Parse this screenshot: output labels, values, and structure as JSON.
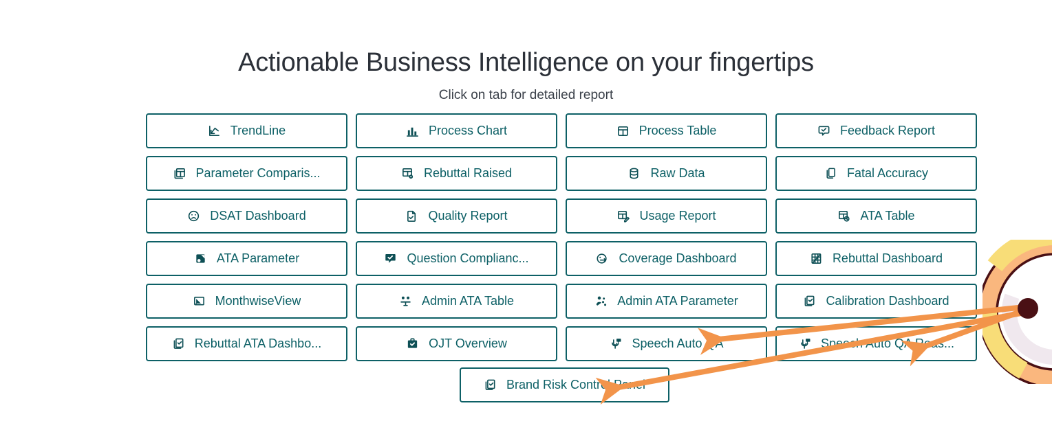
{
  "header": {
    "title": "Actionable Business Intelligence on your fingertips",
    "subtitle": "Click on tab for detailed report"
  },
  "colors": {
    "tab_border": "#0d6066",
    "tab_text": "#0d6066",
    "tab_background": "#ffffff",
    "title_text": "#2b3038",
    "arrow": "#f2944a",
    "decor_outer_ring": "#fab77e",
    "decor_ring_outline": "#4a1014",
    "decor_top_arc": "#f8dd78",
    "decor_inner_fill": "#f0e8ee",
    "arrow_origin_dot": "#4a1014",
    "page_background": "#ffffff"
  },
  "tabs": [
    {
      "label": "TrendLine",
      "icon": "trendline-chart-icon"
    },
    {
      "label": "Process Chart",
      "icon": "bar-chart-icon"
    },
    {
      "label": "Process Table",
      "icon": "table-grid-icon"
    },
    {
      "label": "Feedback Report",
      "icon": "comment-check-icon"
    },
    {
      "label": "Parameter Comparis...",
      "icon": "table-copy-icon"
    },
    {
      "label": "Rebuttal Raised",
      "icon": "table-settings-icon"
    },
    {
      "label": "Raw Data",
      "icon": "database-icon"
    },
    {
      "label": "Fatal Accuracy",
      "icon": "copy-document-icon"
    },
    {
      "label": "DSAT Dashboard",
      "icon": "frowning-face-icon"
    },
    {
      "label": "Quality Report",
      "icon": "document-check-icon"
    },
    {
      "label": "Usage Report",
      "icon": "table-edit-icon"
    },
    {
      "label": "ATA Table",
      "icon": "table-clock-icon"
    },
    {
      "label": "ATA Parameter",
      "icon": "filled-square-icon"
    },
    {
      "label": "Question Complianc...",
      "icon": "filled-comment-check-icon"
    },
    {
      "label": "Coverage Dashboard",
      "icon": "arrow-circle-right-icon"
    },
    {
      "label": "Rebuttal Dashboard",
      "icon": "grid-diagonal-icon"
    },
    {
      "label": "MonthwiseView",
      "icon": "cast-screen-icon"
    },
    {
      "label": "Admin ATA Table",
      "icon": "users-group-icon"
    },
    {
      "label": "Admin ATA Parameter",
      "icon": "user-settings-icon"
    },
    {
      "label": "Calibration Dashboard",
      "icon": "clipboard-check-icon"
    },
    {
      "label": "Rebuttal ATA Dashbo...",
      "icon": "clipboard-check-icon"
    },
    {
      "label": "OJT Overview",
      "icon": "filled-briefcase-check-icon"
    },
    {
      "label": "Speech Auto QA",
      "icon": "microphone-comment-icon"
    },
    {
      "label": "Speech Auto QA Reas...",
      "icon": "microphone-comment-icon"
    }
  ],
  "last_tab": {
    "label": "Brand Risk Control Panel",
    "icon": "clipboard-check-icon"
  },
  "annotations": {
    "arrows": [
      {
        "name": "arrow-to-speech-auto-qa",
        "target": "Speech Auto QA"
      },
      {
        "name": "arrow-to-speech-auto-qa-reasons",
        "target": "Speech Auto QA Reas..."
      },
      {
        "name": "arrow-to-brand-risk-control-panel",
        "target": "Brand Risk Control Panel"
      }
    ],
    "origin_label": "arrow-origin-dot"
  }
}
